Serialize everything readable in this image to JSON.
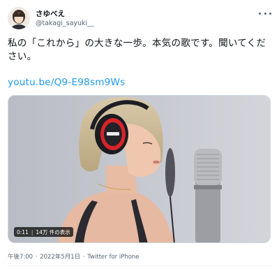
{
  "author": {
    "display_name": "さゆべえ",
    "handle": "@takagi_sayuki__"
  },
  "tweet": {
    "text": "私の「これから」の大きな一歩。本気の歌です。聞いてください。",
    "link": "youtu.be/Q9-E98sm9Ws"
  },
  "media": {
    "duration": "0:11",
    "views": "14万 件の表示"
  },
  "meta": {
    "time": "午後7:00",
    "separator": "·",
    "date": "2022年5月1日",
    "source": "Twitter for iPhone"
  },
  "colors": {
    "link": "#1d9bf0",
    "secondary_text": "#536471",
    "headphone_accent": "#d8232a"
  }
}
